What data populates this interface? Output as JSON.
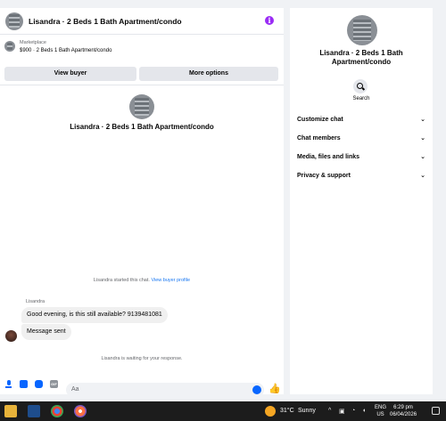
{
  "chat": {
    "title": "Lisandra · 2 Beds 1 Bath Apartment/condo",
    "listing": {
      "category": "Marketplace",
      "price_title": "$900 · 2 Beds 1 Bath Apartment/condo",
      "view_buyer_label": "View buyer",
      "more_options_label": "More options"
    },
    "profile_name": "Lisandra · 2 Beds 1 Bath Apartment/condo",
    "started_text": "Lisandra started this chat.",
    "view_profile_link": "View buyer profile",
    "sender_name": "Lisandra",
    "messages": [
      "Good evening, is this still available? 9139481081",
      "Message sent"
    ],
    "waiting_text": "Lisandra is waiting for your response.",
    "composer_placeholder": "Aa",
    "accent_color": "#0866ff",
    "info_color": "#9a2cf5"
  },
  "side_panel": {
    "name": "Lisandra · 2 Beds 1 Bath Apartment/condo",
    "search_label": "Search",
    "menu": [
      "Customize chat",
      "Chat members",
      "Media, files and links",
      "Privacy & support"
    ]
  },
  "taskbar": {
    "temperature": "31°C",
    "condition": "Sunny",
    "lang": "ENG",
    "region": "US",
    "time": "6:29 pm",
    "date": "06/04/2026"
  }
}
